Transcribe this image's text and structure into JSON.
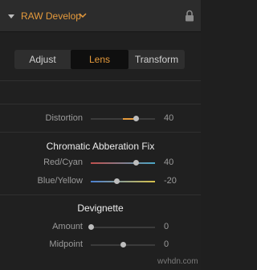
{
  "header": {
    "title": "RAW Develop",
    "chevron_icon": "chevron-down-icon",
    "lock_icon": "lock-icon",
    "caret_icon": "caret-down-icon"
  },
  "tabs": [
    {
      "label": "Adjust",
      "active": false
    },
    {
      "label": "Lens",
      "active": true
    },
    {
      "label": "Transform",
      "active": false
    }
  ],
  "distortion": {
    "label": "Distortion",
    "value": "40",
    "level": 0.7
  },
  "chromatic": {
    "title": "Chromatic Abberation Fix",
    "red_cyan": {
      "label": "Red/Cyan",
      "value": "40",
      "level": 0.7
    },
    "blue_yellow": {
      "label": "Blue/Yellow",
      "value": "-20",
      "level": 0.4
    }
  },
  "devignette": {
    "title": "Devignette",
    "amount": {
      "label": "Amount",
      "value": "0",
      "level": 0.0
    },
    "midpoint": {
      "label": "Midpoint",
      "value": "0",
      "level": 0.5
    }
  },
  "colors": {
    "accent": "#e59a3c",
    "red": "#c0504d",
    "cyan": "#4aa8c8",
    "blue": "#4a7fd0",
    "yellow": "#d8c24a"
  },
  "watermark": "wvhdn.com"
}
